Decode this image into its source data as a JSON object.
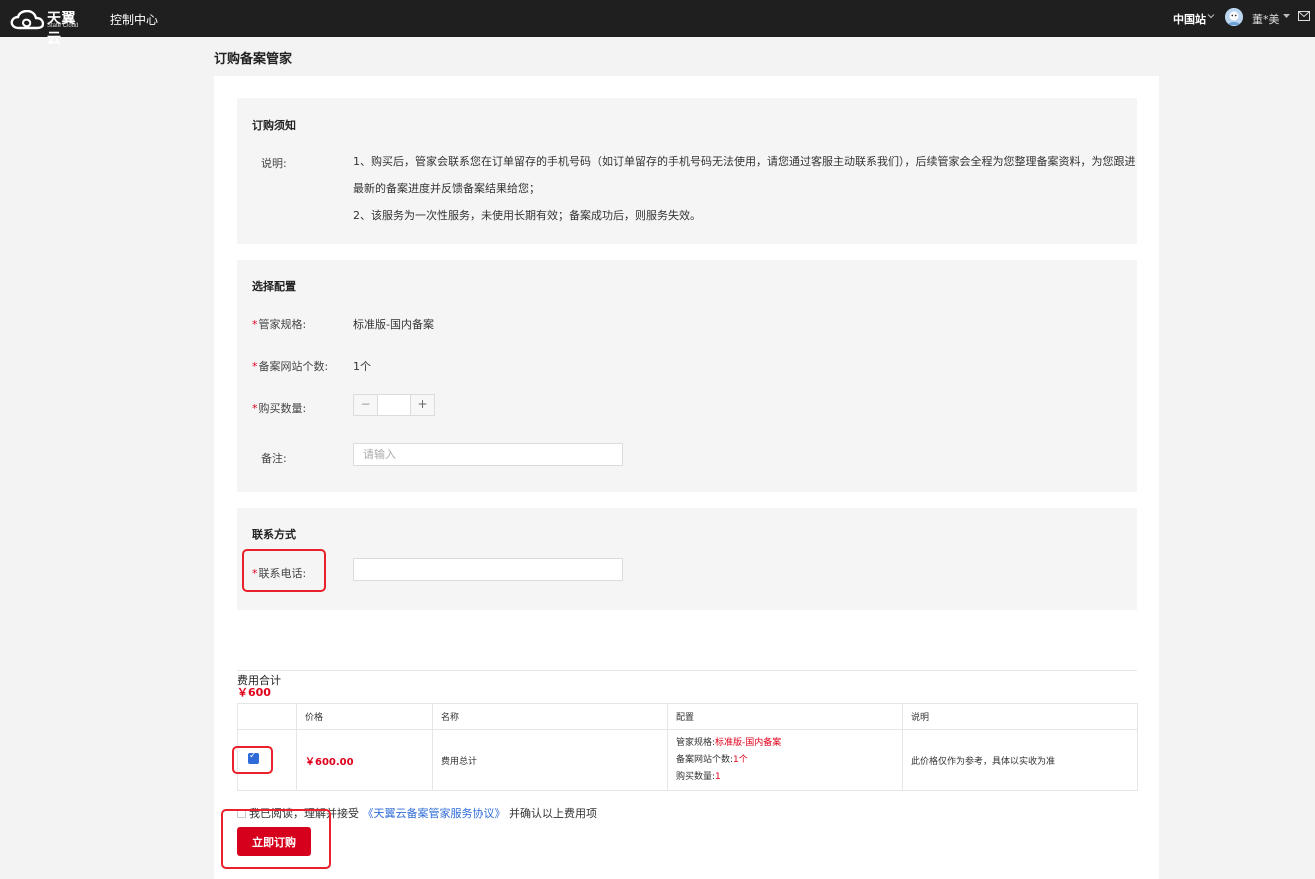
{
  "topbar": {
    "logo_text": "天翼云",
    "logo_sub": "State Cloud",
    "console": "控制中心",
    "region": "中国站",
    "username": "董*美",
    "icons": [
      "cloud-logo-icon",
      "chevron-down-icon",
      "avatar",
      "mail-icon"
    ]
  },
  "page": {
    "title": "订购备案管家"
  },
  "notice": {
    "title": "订购须知",
    "label": "说明:",
    "lines": [
      "1、购买后，管家会联系您在订单留存的手机号码（如订单留存的手机号码无法使用，请您通过客服主动联系我们），后续管家会全程为您整理备案资料，为您跟进",
      "最新的备案进度并反馈备案结果给您；",
      "2、该服务为一次性服务，未使用长期有效；备案成功后，则服务失效。"
    ]
  },
  "config": {
    "title": "选择配置",
    "spec_label": "管家规格:",
    "spec_value": "标准版-国内备案",
    "sites_label": "备案网站个数:",
    "sites_value": "1个",
    "qty_label": "购买数量:",
    "qty_minus": "−",
    "qty_plus": "+",
    "qty_value": "",
    "remark_label": "备注:",
    "remark_placeholder": "请输入"
  },
  "contact": {
    "title": "联系方式",
    "phone_label": "联系电话:",
    "phone_value": ""
  },
  "cost": {
    "label": "费用合计",
    "total": "￥600",
    "headers": [
      "",
      "价格",
      "名称",
      "配置",
      "说明"
    ],
    "row": {
      "price": "￥600.00",
      "name": "费用总计",
      "cfg": [
        {
          "k": "管家规格:",
          "v": "标准版-国内备案"
        },
        {
          "k": "备案网站个数:",
          "v": "1个"
        },
        {
          "k": "购买数量:",
          "v": "1"
        }
      ],
      "note": "此价格仅作为参考，具体以实收为准",
      "checked": true
    }
  },
  "agreement": {
    "prefix": "我已阅读，理解并接受",
    "link": "《天翼云备案管家服务协议》",
    "suffix": "并确认以上费用项"
  },
  "actions": {
    "order_label": "立即订购"
  },
  "colors": {
    "accent": "#d6001c",
    "link": "#2f6cd8",
    "topbar": "#1f1f1f",
    "highlight": "#e8212b"
  }
}
